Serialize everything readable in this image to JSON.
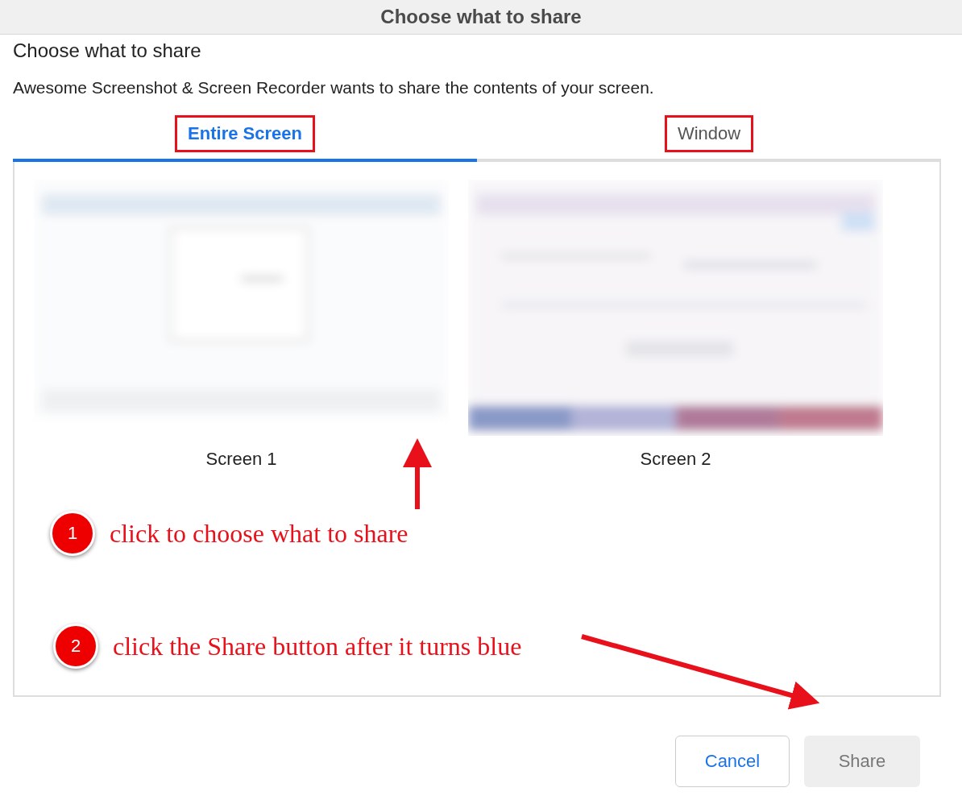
{
  "window": {
    "title": "Choose what to share"
  },
  "heading": "Choose what to share",
  "description": "Awesome Screenshot & Screen Recorder wants to share the contents of your screen.",
  "tabs": [
    {
      "label": "Entire Screen",
      "selected": true,
      "highlighted": true
    },
    {
      "label": "Window",
      "selected": false,
      "highlighted": true
    }
  ],
  "screens": [
    {
      "label": "Screen 1",
      "kind": "picture"
    },
    {
      "label": "Screen 2",
      "kind": "picture"
    }
  ],
  "annotations": [
    {
      "number": "1",
      "text": "click to choose what to share"
    },
    {
      "number": "2",
      "text": "click the Share button after it turns blue"
    }
  ],
  "buttons": [
    {
      "label": "Cancel",
      "disabled": false
    },
    {
      "label": "Share",
      "disabled": true
    }
  ]
}
